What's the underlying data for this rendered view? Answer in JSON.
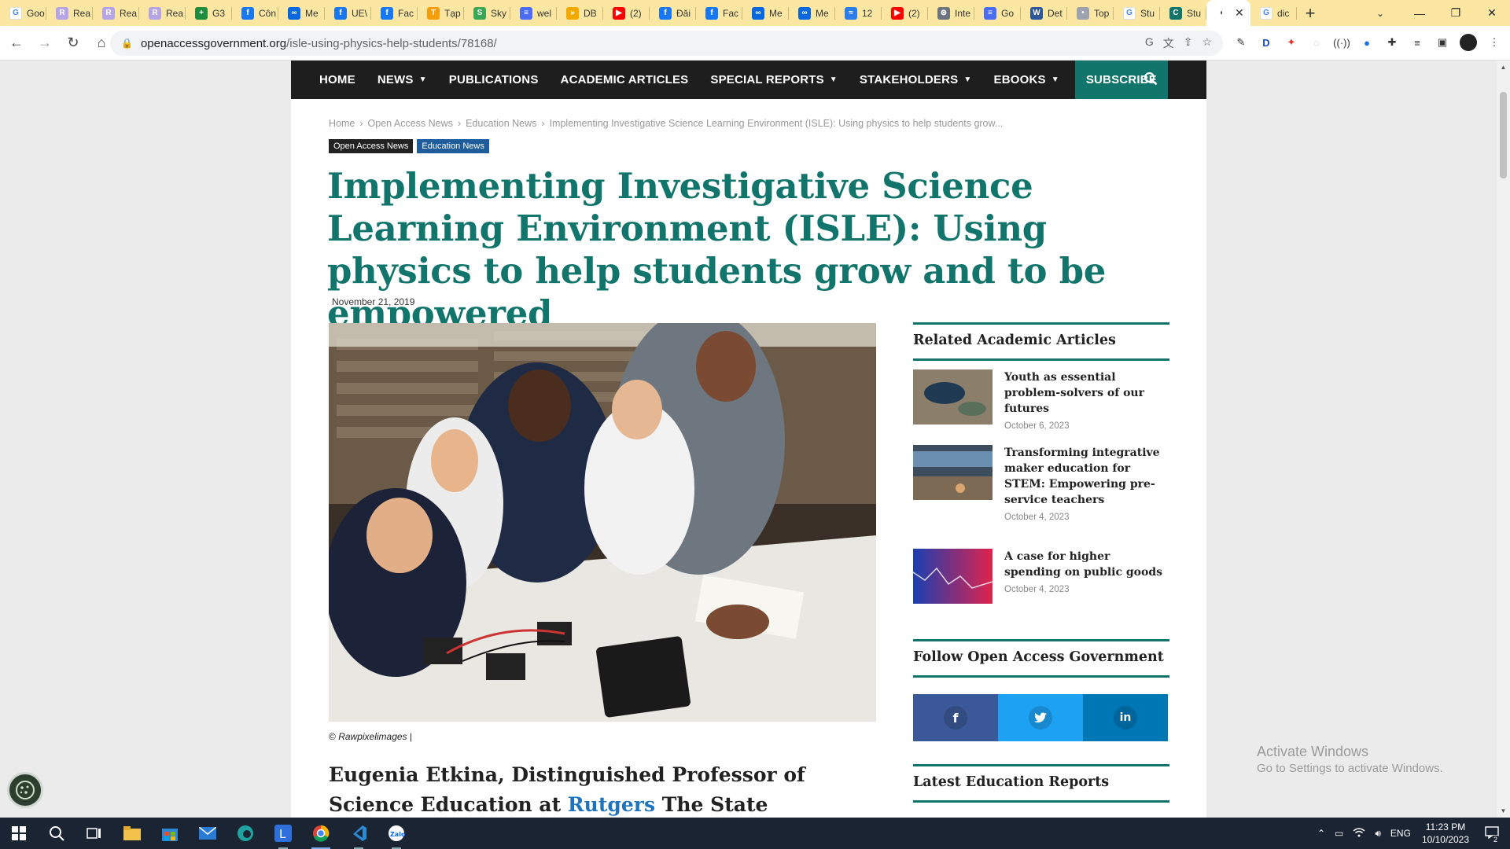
{
  "browser": {
    "tabs": [
      {
        "label": "Goo",
        "color": "#ffffff",
        "glyph": "G"
      },
      {
        "label": "Rea",
        "color": "#b6a5e6",
        "glyph": "R"
      },
      {
        "label": "Rea",
        "color": "#b6a5e6",
        "glyph": "R"
      },
      {
        "label": "Rea",
        "color": "#b6a5e6",
        "glyph": "R"
      },
      {
        "label": "G3",
        "color": "#1e8e3e",
        "glyph": "+"
      },
      {
        "label": "Côn",
        "color": "#1877f2",
        "glyph": "f"
      },
      {
        "label": "Me",
        "color": "#0668e1",
        "glyph": "∞"
      },
      {
        "label": "UE\\",
        "color": "#1877f2",
        "glyph": "f"
      },
      {
        "label": "Fac",
        "color": "#1877f2",
        "glyph": "f"
      },
      {
        "label": "Tạp",
        "color": "#f59e0b",
        "glyph": "T"
      },
      {
        "label": "Sky",
        "color": "#3aa757",
        "glyph": "S"
      },
      {
        "label": "wel",
        "color": "#4a6cf7",
        "glyph": "≡"
      },
      {
        "label": "DB",
        "color": "#f2a900",
        "glyph": "»"
      },
      {
        "label": "(2)",
        "color": "#ff0000",
        "glyph": "▶"
      },
      {
        "label": "Đăi",
        "color": "#1877f2",
        "glyph": "f"
      },
      {
        "label": "Fac",
        "color": "#1877f2",
        "glyph": "f"
      },
      {
        "label": "Me",
        "color": "#0668e1",
        "glyph": "∞"
      },
      {
        "label": "Me",
        "color": "#0668e1",
        "glyph": "∞"
      },
      {
        "label": "12",
        "color": "#2b7de9",
        "glyph": "≈"
      },
      {
        "label": "(2)",
        "color": "#ff0000",
        "glyph": "▶"
      },
      {
        "label": "Inte",
        "color": "#6b7280",
        "glyph": "⊛"
      },
      {
        "label": "Go",
        "color": "#4a6cf7",
        "glyph": "≡"
      },
      {
        "label": "Det",
        "color": "#2b579a",
        "glyph": "W"
      },
      {
        "label": "Top",
        "color": "#9ca3af",
        "glyph": "•"
      },
      {
        "label": "Stu",
        "color": "#ffffff",
        "glyph": "G"
      },
      {
        "label": "Stu",
        "color": "#12756b",
        "glyph": "C"
      }
    ],
    "active_tab_glyph": "◐",
    "last_tab": {
      "label": "dic",
      "glyph": "G"
    },
    "url_host": "openaccessgovernment.org",
    "url_path": "/isle-using-physics-help-students/78168/"
  },
  "nav": {
    "items": [
      {
        "label": "HOME",
        "caret": false
      },
      {
        "label": "NEWS",
        "caret": true
      },
      {
        "label": "PUBLICATIONS",
        "caret": false
      },
      {
        "label": "ACADEMIC ARTICLES",
        "caret": false
      },
      {
        "label": "SPECIAL REPORTS",
        "caret": true
      },
      {
        "label": "STAKEHOLDERS",
        "caret": true
      },
      {
        "label": "EBOOKS",
        "caret": true
      }
    ],
    "subscribe": "SUBSCRIBE"
  },
  "breadcrumb": {
    "home": "Home",
    "level1": "Open Access News",
    "level2": "Education News",
    "current": "Implementing Investigative Science Learning Environment (ISLE): Using physics to help students grow..."
  },
  "tags": {
    "first": "Open Access News",
    "second": "Education News"
  },
  "article": {
    "title": "Implementing Investigative Science Learning Environment (ISLE): Using physics to help students grow and to be empowered",
    "date": "November 21, 2019",
    "caption_prefix": "©",
    "caption_credit": "Rawpixelimages",
    "caption_suffix": "|",
    "lead_before": "Eugenia Etkina, Distinguished Professor of Science Education at",
    "lead_link": "Rutgers",
    "lead_after": "The State University of New Jersey,"
  },
  "sidebar": {
    "related_title": "Related Academic Articles",
    "related": [
      {
        "title": "Youth as essential problem-solvers of our futures",
        "date": "October 6, 2023"
      },
      {
        "title": "Transforming integrative maker education for STEM: Empowering pre-service teachers",
        "date": "October 4, 2023"
      },
      {
        "title": "A case for higher spending on public goods",
        "date": "October 4, 2023"
      }
    ],
    "follow_title": "Follow Open Access Government",
    "social": {
      "facebook": "f",
      "twitter": "t",
      "linkedin": "in"
    },
    "latest_title": "Latest Education Reports"
  },
  "watermark": {
    "line1": "Activate Windows",
    "line2": "Go to Settings to activate Windows."
  },
  "taskbar": {
    "lang": "ENG",
    "time": "11:23 PM",
    "date": "10/10/2023",
    "notifications": "2"
  }
}
